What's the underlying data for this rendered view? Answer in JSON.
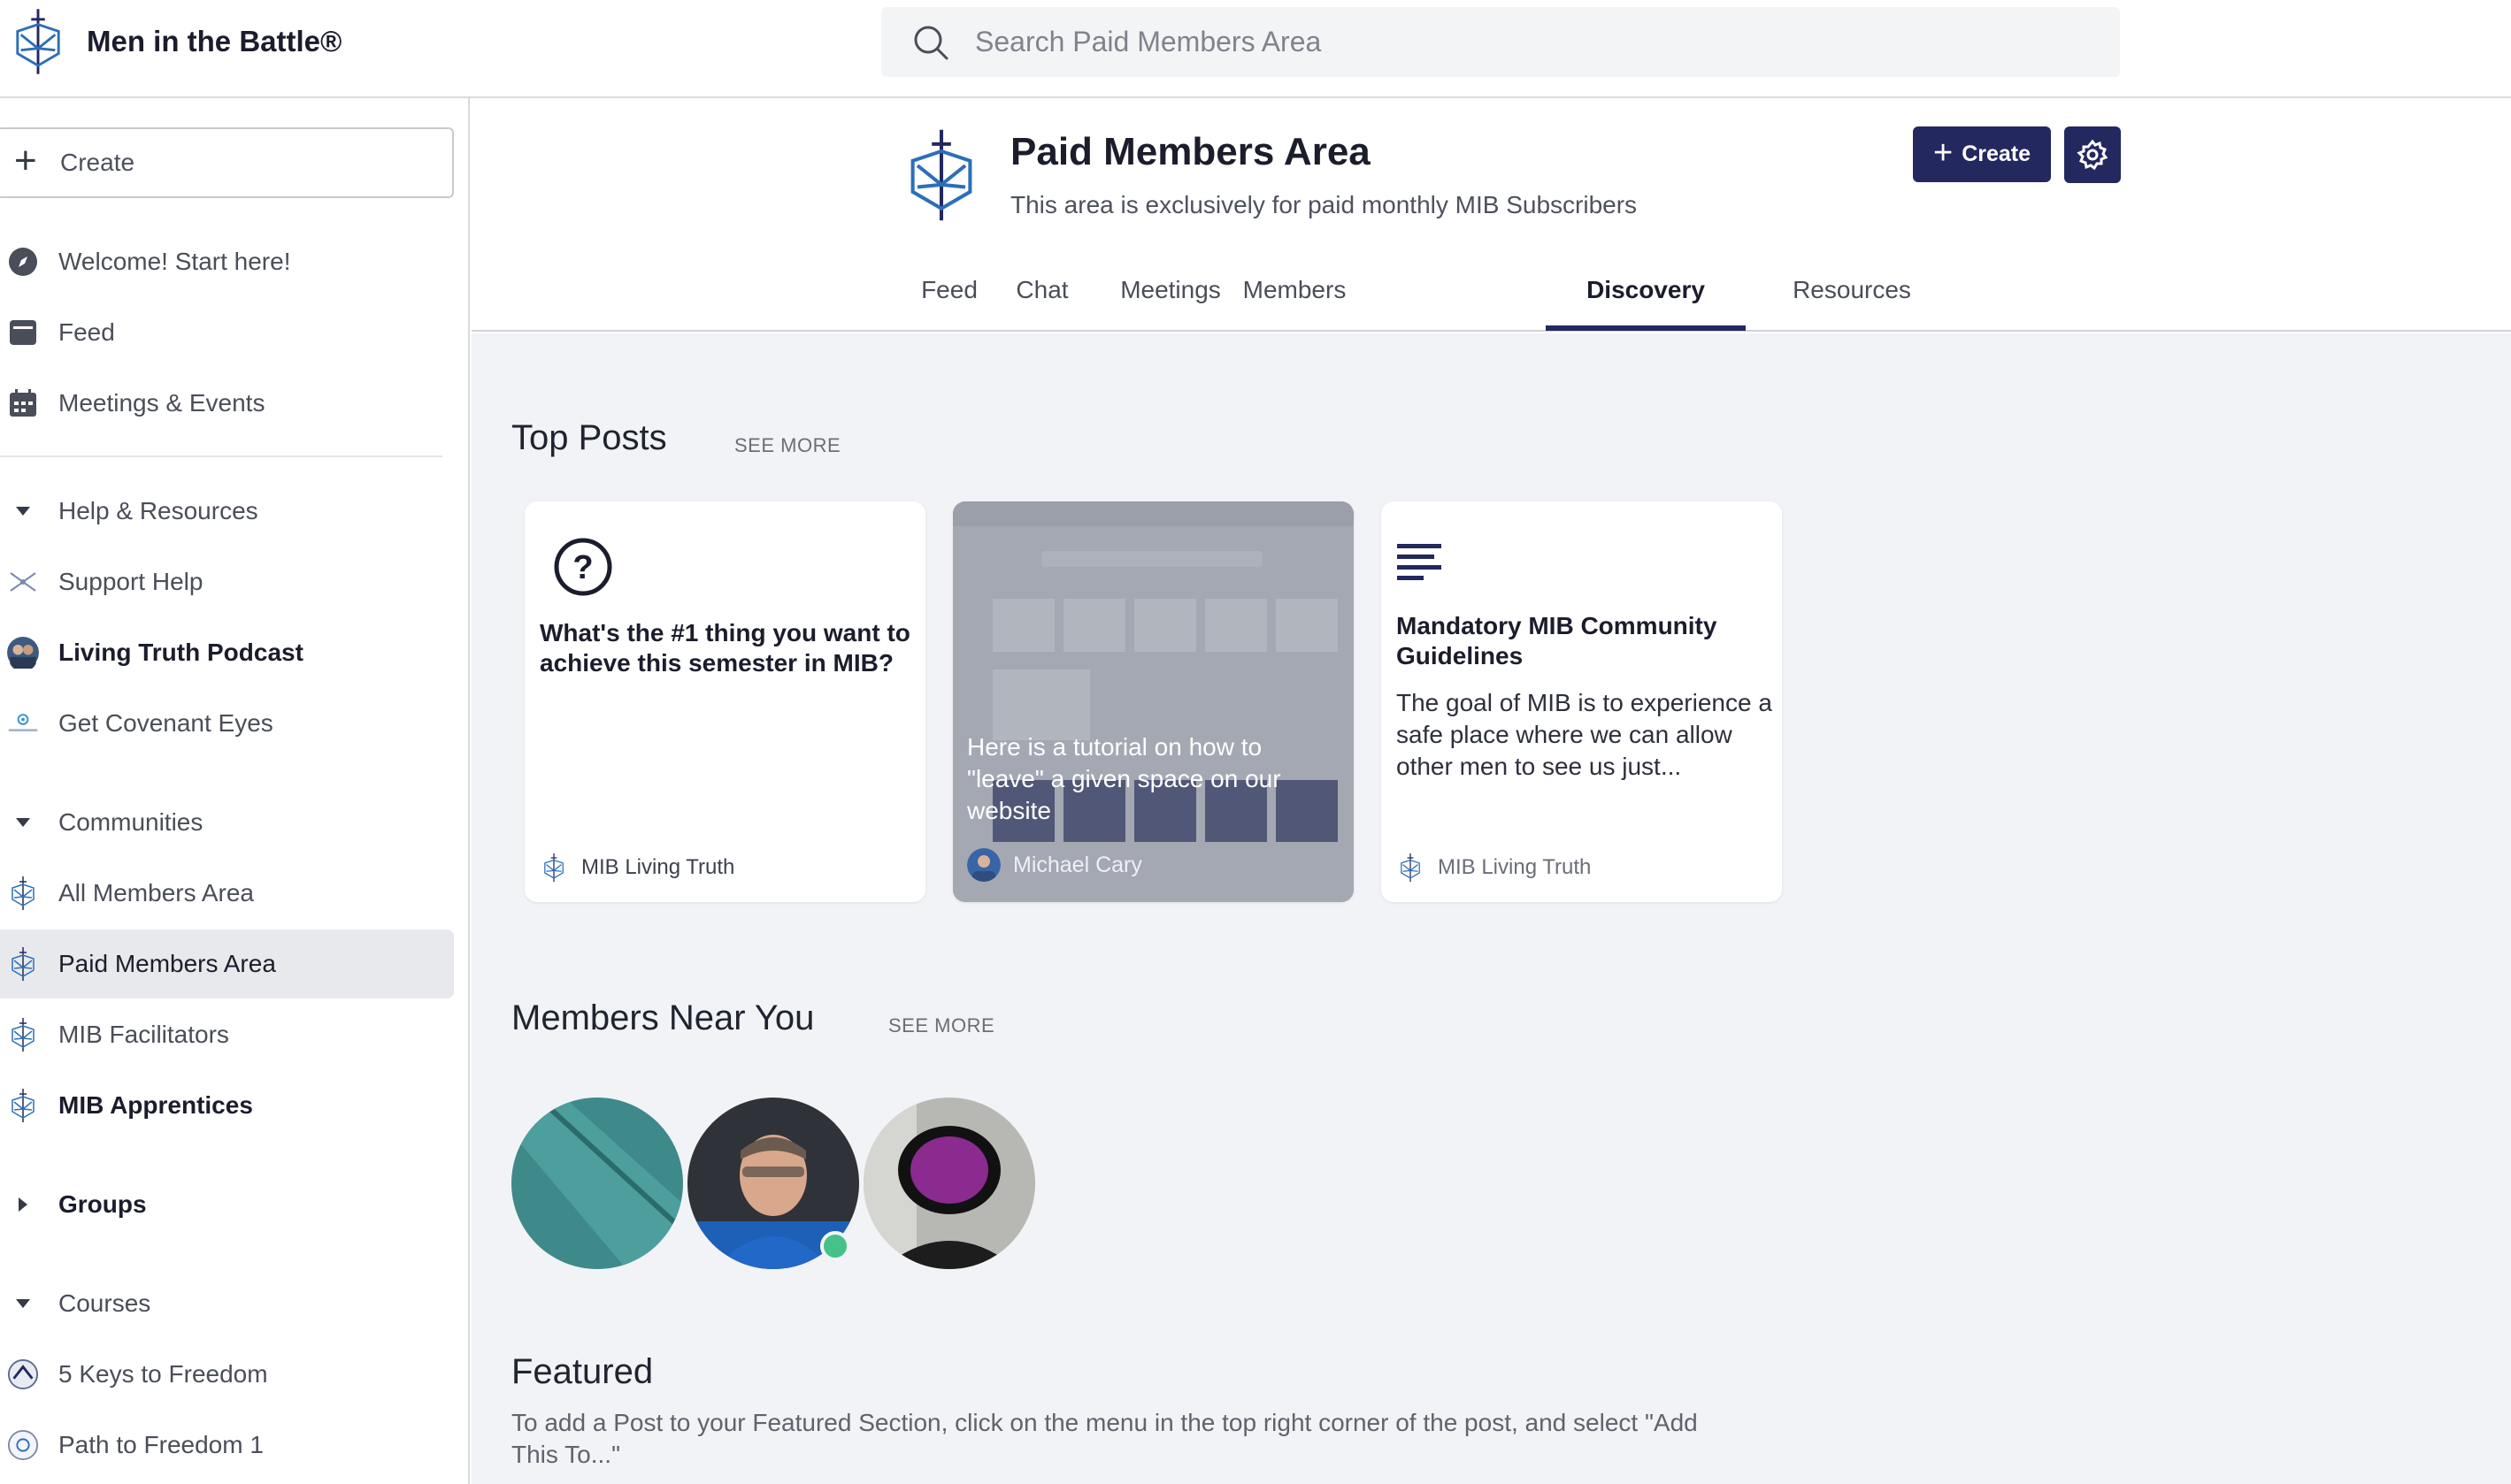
{
  "app": {
    "brand_name": "Men in the Battle®",
    "accent_color": "#23285f"
  },
  "search": {
    "placeholder": "Search Paid Members Area"
  },
  "sidebar": {
    "create_label": "Create",
    "items": [
      {
        "label": "Welcome! Start here!",
        "icon": "compass-icon"
      },
      {
        "label": "Feed",
        "icon": "feed-icon"
      },
      {
        "label": "Meetings & Events",
        "icon": "calendar-icon"
      }
    ],
    "help_section": {
      "label": "Help & Resources",
      "items": [
        {
          "label": "Support Help",
          "icon": "support-logo-icon"
        },
        {
          "label": "Living Truth Podcast",
          "icon": "podcast-avatar"
        },
        {
          "label": "Get Covenant Eyes",
          "icon": "covenant-eyes-icon"
        }
      ]
    },
    "communities_section": {
      "label": "Communities",
      "items": [
        {
          "label": "All Members Area"
        },
        {
          "label": "Paid Members Area",
          "active": true
        },
        {
          "label": "MIB Facilitators"
        },
        {
          "label": "MIB Apprentices"
        }
      ]
    },
    "groups_label": "Groups",
    "courses_section": {
      "label": "Courses",
      "items": [
        {
          "label": "5 Keys to Freedom"
        },
        {
          "label": "Path to Freedom 1"
        }
      ]
    }
  },
  "space": {
    "title": "Paid Members Area",
    "subtitle": "This area is exclusively for paid monthly MIB Subscribers",
    "create_label": "Create",
    "tabs": [
      {
        "label": "Feed"
      },
      {
        "label": "Chat"
      },
      {
        "label": "Meetings"
      },
      {
        "label": "Members"
      },
      {
        "label": "Discovery",
        "active": true
      },
      {
        "label": "Resources"
      }
    ]
  },
  "top_posts": {
    "title": "Top Posts",
    "see_more": "SEE MORE",
    "cards": [
      {
        "title": "What's the #1 thing you want to achieve this semester in MIB?",
        "author": "MIB Living Truth",
        "icon": "question-icon"
      },
      {
        "text": "Here is a tutorial on how to \"leave\" a given space on our website",
        "author": "Michael Cary"
      },
      {
        "title": "Mandatory MIB Community Guidelines",
        "body": "The goal of MIB is to experience a safe place where we can allow other men to see us just...",
        "author": "MIB Living Truth",
        "icon": "text-lines-icon"
      }
    ]
  },
  "members_near_you": {
    "title": "Members Near You",
    "see_more": "SEE MORE"
  },
  "featured": {
    "title": "Featured",
    "text": "To add a Post to your Featured Section, click on the menu in the top right corner of the post, and select \"Add This To...\""
  }
}
